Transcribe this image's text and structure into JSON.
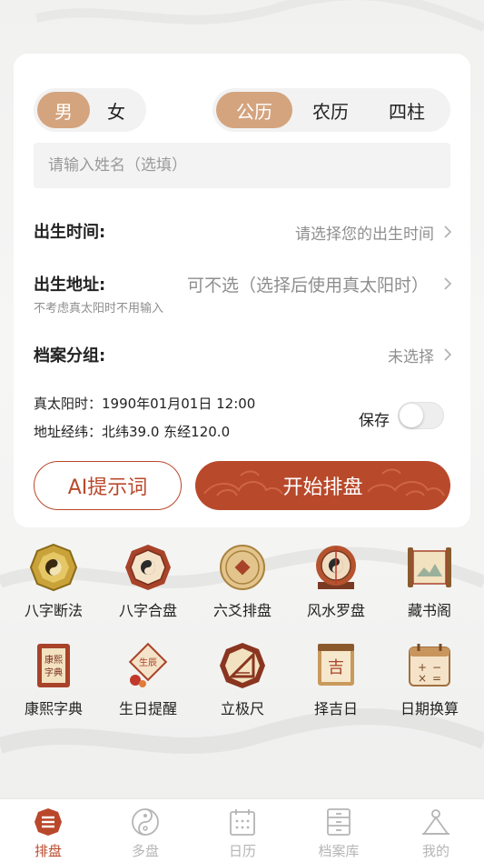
{
  "gender": {
    "male": "男",
    "female": "女",
    "selected": "男"
  },
  "calendar": {
    "options": [
      "公历",
      "农历",
      "四柱"
    ],
    "selected": "公历"
  },
  "name_input": {
    "placeholder": "请输入姓名（选填）",
    "value": ""
  },
  "birth_time": {
    "label": "出生时间:",
    "value": "请选择您的出生时间"
  },
  "birth_place": {
    "label": "出生地址:",
    "value": "可不选（选择后使用真太阳时）",
    "hint": "不考虑真太阳时不用输入"
  },
  "archive_group": {
    "label": "档案分组:",
    "value": "未选择"
  },
  "solar_time": "真太阳时：1990年01月01日 12:00",
  "coordinates": "地址经纬：北纬39.0 东经120.0",
  "save": {
    "label": "保存",
    "on": false
  },
  "buttons": {
    "ai_prompt": "AI提示词",
    "start": "开始排盘"
  },
  "tools": [
    {
      "label": "八字断法",
      "icon": "bagua-gold-icon"
    },
    {
      "label": "八字合盘",
      "icon": "bagua-octagon-icon"
    },
    {
      "label": "六爻排盘",
      "icon": "coin-icon"
    },
    {
      "label": "风水罗盘",
      "icon": "compass-icon"
    },
    {
      "label": "藏书阁",
      "icon": "scroll-icon"
    },
    {
      "label": "康熙字典",
      "icon": "dictionary-icon"
    },
    {
      "label": "生日提醒",
      "icon": "birthday-icon"
    },
    {
      "label": "立极尺",
      "icon": "ruler-icon"
    },
    {
      "label": "择吉日",
      "icon": "calendar-ji-icon"
    },
    {
      "label": "日期换算",
      "icon": "date-calc-icon"
    }
  ],
  "tabs": [
    {
      "label": "排盘",
      "active": true
    },
    {
      "label": "多盘",
      "active": false
    },
    {
      "label": "日历",
      "active": false
    },
    {
      "label": "档案库",
      "active": false
    },
    {
      "label": "我的",
      "active": false
    }
  ],
  "colors": {
    "accent": "#b9482a",
    "segment_active": "#d4a47e",
    "muted": "#8e8e8e"
  }
}
